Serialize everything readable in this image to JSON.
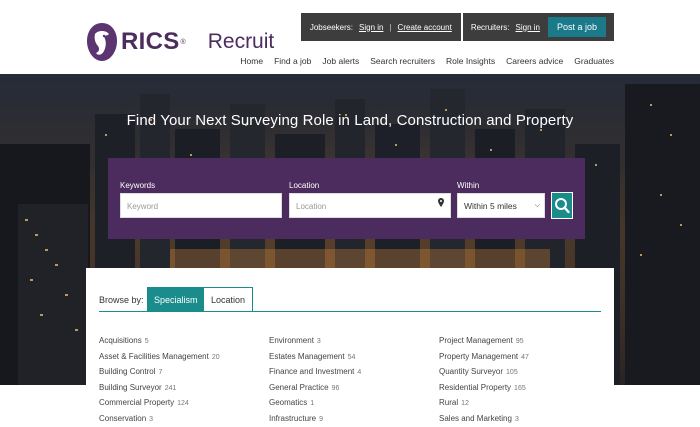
{
  "brand": {
    "name": "RICS",
    "product": "Recruit"
  },
  "topbar": {
    "jobseekers_label": "Jobseekers:",
    "sign_in": "Sign in",
    "separator": "|",
    "create_account": "Create account",
    "recruiters_label": "Recruiters:",
    "recruiters_sign_in": "Sign in",
    "post_job": "Post a job"
  },
  "nav": [
    "Home",
    "Find a job",
    "Job alerts",
    "Search recruiters",
    "Role Insights",
    "Careers advice",
    "Graduates"
  ],
  "hero": {
    "title": "Find Your Next Surveying Role in Land, Construction and Property"
  },
  "search": {
    "keywords_label": "Keywords",
    "keywords_placeholder": "Keyword",
    "location_label": "Location",
    "location_placeholder": "Location",
    "within_label": "Within",
    "within_value": "Within 5 miles",
    "icons": {
      "location": "map-pin-icon",
      "search": "search-icon",
      "select": "chevron-down-icon"
    }
  },
  "browse": {
    "label": "Browse by:",
    "tabs": [
      "Specialism",
      "Location"
    ],
    "active_tab": "Specialism",
    "columns": [
      [
        {
          "name": "Acquisitions",
          "count": "5"
        },
        {
          "name": "Asset & Facilities Management",
          "count": "20"
        },
        {
          "name": "Building Control",
          "count": "7"
        },
        {
          "name": "Building Surveyor",
          "count": "241"
        },
        {
          "name": "Commercial Property",
          "count": "124"
        },
        {
          "name": "Conservation",
          "count": "3"
        }
      ],
      [
        {
          "name": "Environment",
          "count": "3"
        },
        {
          "name": "Estates Management",
          "count": "54"
        },
        {
          "name": "Finance and Investment",
          "count": "4"
        },
        {
          "name": "General Practice",
          "count": "96"
        },
        {
          "name": "Geomatics",
          "count": "1"
        },
        {
          "name": "Infrastructure",
          "count": "9"
        }
      ],
      [
        {
          "name": "Project Management",
          "count": "95"
        },
        {
          "name": "Property Management",
          "count": "47"
        },
        {
          "name": "Quantity Surveyor",
          "count": "105"
        },
        {
          "name": "Residential Property",
          "count": "165"
        },
        {
          "name": "Rural",
          "count": "12"
        },
        {
          "name": "Sales and Marketing",
          "count": "3"
        }
      ]
    ]
  },
  "colors": {
    "brand_purple": "#4c2b5e",
    "accent_teal": "#1a8c8c",
    "topbar_dark": "#3d3d3d"
  }
}
